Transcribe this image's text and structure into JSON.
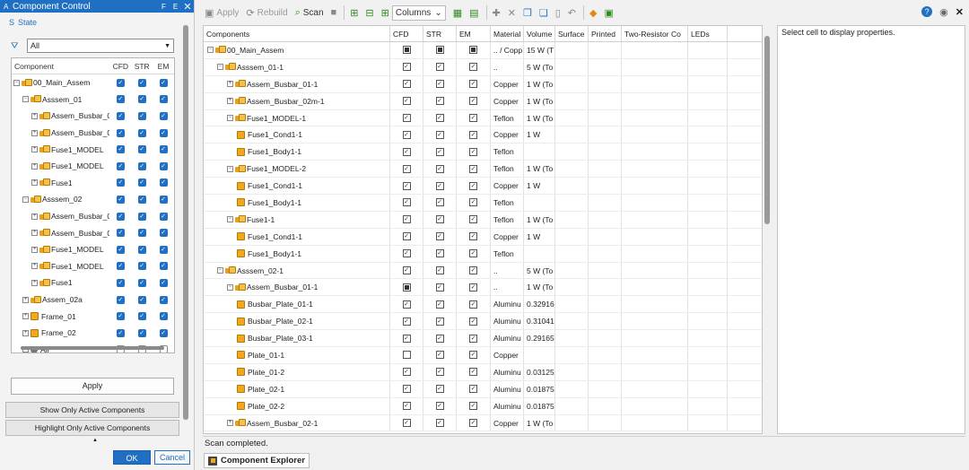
{
  "left_panel": {
    "title": "Component Control",
    "title_icon": "A",
    "title_buttons": [
      "F",
      "E"
    ],
    "state_label": "State",
    "filter_value": "All",
    "headers": {
      "component": "Component",
      "cfd": "CFD",
      "str": "STR",
      "em": "EM"
    },
    "rows": [
      {
        "name": "00_Main_Assem",
        "indent": 0,
        "expander": "−",
        "icon": "assembly-icon",
        "cfd": true,
        "str": true,
        "em": true
      },
      {
        "name": "Asssem_01",
        "indent": 1,
        "expander": "−",
        "icon": "assembly-icon",
        "cfd": true,
        "str": true,
        "em": true
      },
      {
        "name": "Assem_Busbar_0",
        "indent": 2,
        "expander": "+",
        "icon": "assembly-icon",
        "cfd": true,
        "str": true,
        "em": true
      },
      {
        "name": "Assem_Busbar_0",
        "indent": 2,
        "expander": "+",
        "icon": "assembly-icon",
        "cfd": true,
        "str": true,
        "em": true
      },
      {
        "name": "Fuse1_MODEL",
        "indent": 2,
        "expander": "+",
        "icon": "assembly-icon",
        "cfd": true,
        "str": true,
        "em": true
      },
      {
        "name": "Fuse1_MODEL",
        "indent": 2,
        "expander": "+",
        "icon": "assembly-icon",
        "cfd": true,
        "str": true,
        "em": true
      },
      {
        "name": "Fuse1",
        "indent": 2,
        "expander": "+",
        "icon": "assembly-icon",
        "cfd": true,
        "str": true,
        "em": true
      },
      {
        "name": "Asssem_02",
        "indent": 1,
        "expander": "−",
        "icon": "assembly-icon",
        "cfd": true,
        "str": true,
        "em": true
      },
      {
        "name": "Assem_Busbar_0",
        "indent": 2,
        "expander": "+",
        "icon": "assembly-icon",
        "cfd": true,
        "str": true,
        "em": true
      },
      {
        "name": "Assem_Busbar_0",
        "indent": 2,
        "expander": "+",
        "icon": "assembly-icon",
        "cfd": true,
        "str": true,
        "em": true
      },
      {
        "name": "Fuse1_MODEL",
        "indent": 2,
        "expander": "+",
        "icon": "assembly-icon",
        "cfd": true,
        "str": true,
        "em": true
      },
      {
        "name": "Fuse1_MODEL",
        "indent": 2,
        "expander": "+",
        "icon": "assembly-icon",
        "cfd": true,
        "str": true,
        "em": true
      },
      {
        "name": "Fuse1",
        "indent": 2,
        "expander": "+",
        "icon": "assembly-icon",
        "cfd": true,
        "str": true,
        "em": true
      },
      {
        "name": "Assem_02a",
        "indent": 1,
        "expander": "+",
        "icon": "assembly-icon",
        "cfd": true,
        "str": true,
        "em": true
      },
      {
        "name": "Frame_01",
        "indent": 1,
        "expander": "+",
        "icon": "part-icon",
        "cfd": true,
        "str": true,
        "em": true
      },
      {
        "name": "Frame_02",
        "indent": 1,
        "expander": "+",
        "icon": "part-icon",
        "cfd": true,
        "str": true,
        "em": true
      },
      {
        "name": "Air",
        "indent": 1,
        "expander": "+",
        "icon": "air-icon",
        "cfd": false,
        "str": false,
        "em": false
      }
    ],
    "apply_label": "Apply",
    "show_active_label": "Show Only Active Components",
    "highlight_active_label": "Highlight Only Active Components",
    "ok_label": "OK",
    "cancel_label": "Cancel"
  },
  "toolbar": {
    "apply_label": "Apply",
    "rebuild_label": "Rebuild",
    "scan_label": "Scan",
    "columns_label": "Columns"
  },
  "grid": {
    "headers": [
      "Components",
      "CFD",
      "STR",
      "EM",
      "Material",
      "Volume",
      "Surface",
      "Printed",
      "Two-Resistor Co",
      "LEDs"
    ],
    "rows": [
      {
        "name": "00_Main_Assem",
        "indent": 0,
        "expander": "−",
        "icon": "assembly-icon",
        "cfd": "part",
        "str": "part",
        "em": "part",
        "material": ".. / Copp",
        "volume": "15 W (T"
      },
      {
        "name": "Asssem_01-1",
        "indent": 1,
        "expander": "−",
        "icon": "assembly-icon",
        "cfd": "on",
        "str": "on",
        "em": "on",
        "material": "..",
        "volume": "5 W (To"
      },
      {
        "name": "Assem_Busbar_01-1",
        "indent": 2,
        "expander": "+",
        "icon": "assembly-icon",
        "cfd": "on",
        "str": "on",
        "em": "on",
        "material": "Copper",
        "volume": "1 W (To"
      },
      {
        "name": "Assem_Busbar_02m-1",
        "indent": 2,
        "expander": "+",
        "icon": "assembly-icon",
        "cfd": "on",
        "str": "on",
        "em": "on",
        "material": "Copper",
        "volume": "1 W (To"
      },
      {
        "name": "Fuse1_MODEL-1",
        "indent": 2,
        "expander": "−",
        "icon": "assembly-icon",
        "cfd": "on",
        "str": "on",
        "em": "on",
        "material": "Teflon",
        "volume": "1 W (To"
      },
      {
        "name": "Fuse1_Cond1-1",
        "indent": 3,
        "expander": "",
        "icon": "part-icon",
        "cfd": "on",
        "str": "on",
        "em": "on",
        "material": "Copper",
        "volume": "1 W"
      },
      {
        "name": "Fuse1_Body1-1",
        "indent": 3,
        "expander": "",
        "icon": "part-icon",
        "cfd": "on",
        "str": "on",
        "em": "on",
        "material": "Teflon",
        "volume": ""
      },
      {
        "name": "Fuse1_MODEL-2",
        "indent": 2,
        "expander": "−",
        "icon": "assembly-icon",
        "cfd": "on",
        "str": "on",
        "em": "on",
        "material": "Teflon",
        "volume": "1 W (To"
      },
      {
        "name": "Fuse1_Cond1-1",
        "indent": 3,
        "expander": "",
        "icon": "part-icon",
        "cfd": "on",
        "str": "on",
        "em": "on",
        "material": "Copper",
        "volume": "1 W"
      },
      {
        "name": "Fuse1_Body1-1",
        "indent": 3,
        "expander": "",
        "icon": "part-icon",
        "cfd": "on",
        "str": "on",
        "em": "on",
        "material": "Teflon",
        "volume": ""
      },
      {
        "name": "Fuse1-1",
        "indent": 2,
        "expander": "−",
        "icon": "assembly-icon",
        "cfd": "on",
        "str": "on",
        "em": "on",
        "material": "Teflon",
        "volume": "1 W (To"
      },
      {
        "name": "Fuse1_Cond1-1",
        "indent": 3,
        "expander": "",
        "icon": "part-icon",
        "cfd": "on",
        "str": "on",
        "em": "on",
        "material": "Copper",
        "volume": "1 W"
      },
      {
        "name": "Fuse1_Body1-1",
        "indent": 3,
        "expander": "",
        "icon": "part-icon",
        "cfd": "on",
        "str": "on",
        "em": "on",
        "material": "Teflon",
        "volume": ""
      },
      {
        "name": "Asssem_02-1",
        "indent": 1,
        "expander": "−",
        "icon": "assembly-icon",
        "cfd": "on",
        "str": "on",
        "em": "on",
        "material": "..",
        "volume": "5 W (To"
      },
      {
        "name": "Assem_Busbar_01-1",
        "indent": 2,
        "expander": "−",
        "icon": "assembly-icon",
        "cfd": "part",
        "str": "on",
        "em": "on",
        "material": "..",
        "volume": "1 W (To"
      },
      {
        "name": "Busbar_Plate_01-1",
        "indent": 3,
        "expander": "",
        "icon": "part-icon",
        "cfd": "on",
        "str": "on",
        "em": "on",
        "material": "Aluminu",
        "volume": "0.32916"
      },
      {
        "name": "Busbar_Plate_02-1",
        "indent": 3,
        "expander": "",
        "icon": "part-icon",
        "cfd": "on",
        "str": "on",
        "em": "on",
        "material": "Aluminu",
        "volume": "0.31041"
      },
      {
        "name": "Busbar_Plate_03-1",
        "indent": 3,
        "expander": "",
        "icon": "part-icon",
        "cfd": "on",
        "str": "on",
        "em": "on",
        "material": "Aluminu",
        "volume": "0.29165"
      },
      {
        "name": "Plate_01-1",
        "indent": 3,
        "expander": "",
        "icon": "part-icon",
        "cfd": "off",
        "str": "on",
        "em": "on",
        "material": "Copper",
        "volume": ""
      },
      {
        "name": "Plate_01-2",
        "indent": 3,
        "expander": "",
        "icon": "part-icon",
        "cfd": "on",
        "str": "on",
        "em": "on",
        "material": "Aluminu",
        "volume": "0.03125"
      },
      {
        "name": "Plate_02-1",
        "indent": 3,
        "expander": "",
        "icon": "part-icon",
        "cfd": "on",
        "str": "on",
        "em": "on",
        "material": "Aluminu",
        "volume": "0.01875"
      },
      {
        "name": "Plate_02-2",
        "indent": 3,
        "expander": "",
        "icon": "part-icon",
        "cfd": "on",
        "str": "on",
        "em": "on",
        "material": "Aluminu",
        "volume": "0.01875"
      },
      {
        "name": "Assem_Busbar_02-1",
        "indent": 2,
        "expander": "+",
        "icon": "assembly-icon",
        "cfd": "on",
        "str": "on",
        "em": "on",
        "material": "Copper",
        "volume": "1 W (To"
      }
    ]
  },
  "properties": {
    "placeholder": "Select cell to display properties."
  },
  "status": {
    "text": "Scan completed."
  },
  "bottom_tab": {
    "label": "Component Explorer"
  }
}
